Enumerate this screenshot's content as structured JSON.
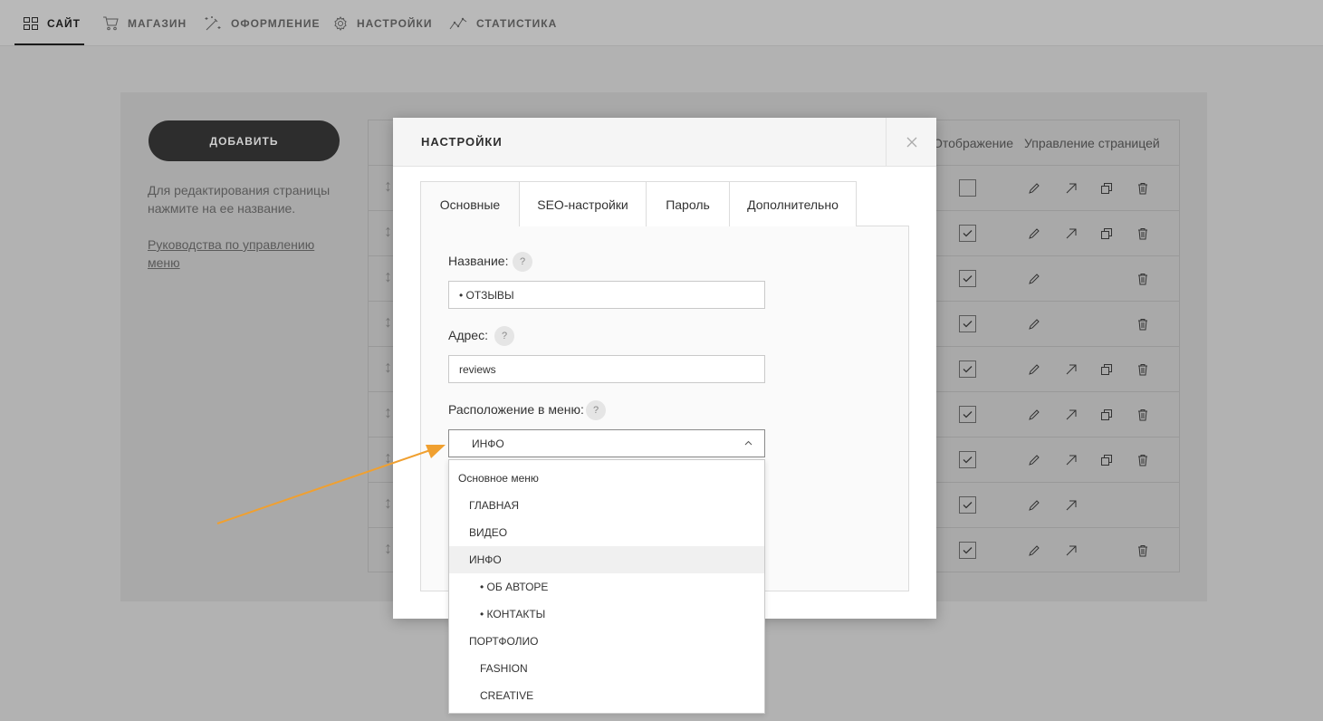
{
  "nav": {
    "items": [
      {
        "label": "САЙТ",
        "icon": "grid-icon",
        "active": true
      },
      {
        "label": "МАГАЗИН",
        "icon": "cart-icon"
      },
      {
        "label": "ОФОРМЛЕНИЕ",
        "icon": "magic-wand-icon"
      },
      {
        "label": "НАСТРОЙКИ",
        "icon": "gear-icon"
      },
      {
        "label": "СТАТИСТИКА",
        "icon": "stats-icon"
      }
    ]
  },
  "sidebar": {
    "add_button": "ДОБАВИТЬ",
    "hint": "Для редактирования страницы нажмите на ее название.",
    "guide_link": "Руководства по управлению меню"
  },
  "table": {
    "headers": {
      "display": "Отображение",
      "manage": "Управление страницей"
    },
    "rows": [
      {
        "checked": false,
        "icons": [
          "edit-icon",
          "open-link-icon",
          "copy-icon",
          "trash-icon"
        ]
      },
      {
        "checked": true,
        "icons": [
          "edit-icon",
          "open-link-icon",
          "copy-icon",
          "trash-icon"
        ]
      },
      {
        "checked": true,
        "icons": [
          "edit-icon",
          "trash-icon"
        ]
      },
      {
        "checked": true,
        "icons": [
          "edit-icon",
          "trash-icon"
        ]
      },
      {
        "checked": true,
        "icons": [
          "edit-icon",
          "open-link-icon",
          "copy-icon",
          "trash-icon"
        ]
      },
      {
        "checked": true,
        "icons": [
          "edit-icon",
          "open-link-icon",
          "copy-icon",
          "trash-icon"
        ]
      },
      {
        "checked": true,
        "icons": [
          "edit-icon",
          "open-link-icon",
          "copy-icon",
          "trash-icon"
        ]
      },
      {
        "checked": true,
        "icons": [
          "edit-icon",
          "open-link-icon"
        ]
      },
      {
        "checked": true,
        "icons": [
          "edit-icon",
          "open-link-icon",
          "trash-icon"
        ]
      }
    ]
  },
  "modal": {
    "title": "НАСТРОЙКИ",
    "tabs": [
      "Основные",
      "SEO-настройки",
      "Пароль",
      "Дополнительно"
    ],
    "name_label": "Название:",
    "name_value": "• ОТЗЫВЫ",
    "address_label": "Адрес:",
    "address_value": "reviews",
    "menu_label": "Расположение в меню:",
    "menu_selected": "ИНФО",
    "help_glyph": "?",
    "menu_options": [
      {
        "label": "Основное меню",
        "level": 0
      },
      {
        "label": "ГЛАВНАЯ",
        "level": 1
      },
      {
        "label": "ВИДЕО",
        "level": 1
      },
      {
        "label": "ИНФО",
        "level": 1,
        "selected": true
      },
      {
        "label": "• ОБ АВТОРЕ",
        "level": 2
      },
      {
        "label": "• КОНТАКТЫ",
        "level": 2
      },
      {
        "label": "ПОРТФОЛИО",
        "level": 1
      },
      {
        "label": "FASHION",
        "level": 2
      },
      {
        "label": "CREATIVE",
        "level": 2
      }
    ]
  },
  "colors": {
    "accent_arrow": "#f0a030",
    "dark": "#2d2d2d"
  }
}
